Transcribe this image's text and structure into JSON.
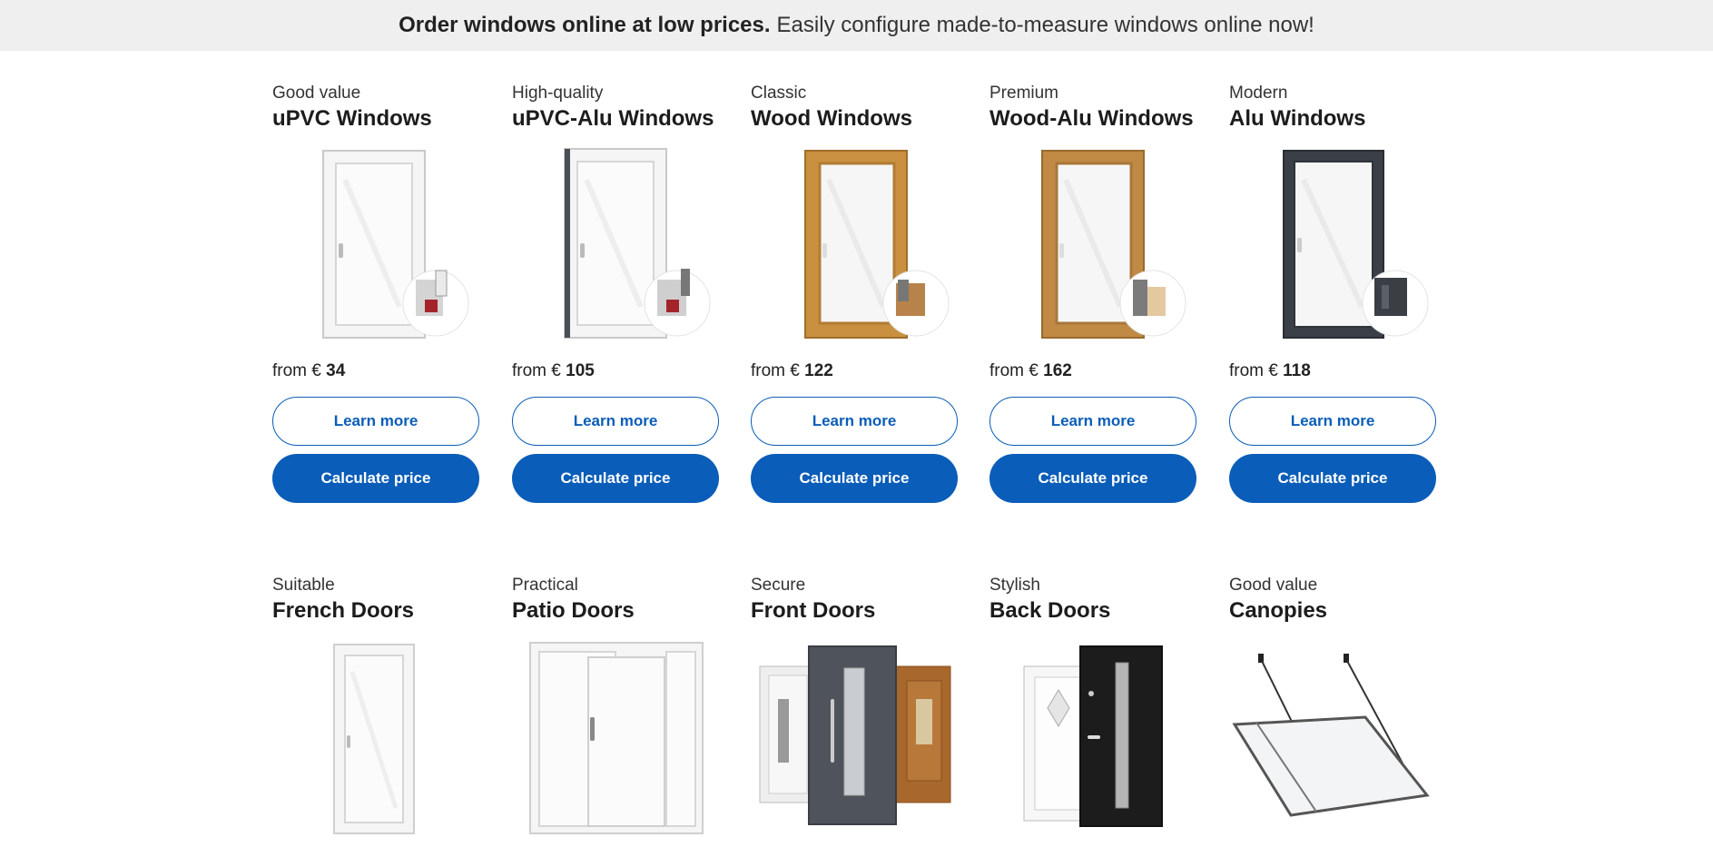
{
  "banner": {
    "bold": "Order windows online at low prices.",
    "text": "Easily configure made-to-measure windows online now!"
  },
  "windows": [
    {
      "subtitle": "Good value",
      "title": "uPVC Windows",
      "price_prefix": "from €",
      "price": "34",
      "learn": "Learn more",
      "calc": "Calculate price",
      "frame_color": "#f4f4f4"
    },
    {
      "subtitle": "High-quality",
      "title": "uPVC-Alu Windows",
      "price_prefix": "from €",
      "price": "105",
      "learn": "Learn more",
      "calc": "Calculate price",
      "frame_color": "#f4f4f4"
    },
    {
      "subtitle": "Classic",
      "title": "Wood Windows",
      "price_prefix": "from €",
      "price": "122",
      "learn": "Learn more",
      "calc": "Calculate price",
      "frame_color": "#c9913f"
    },
    {
      "subtitle": "Premium",
      "title": "Wood-Alu Windows",
      "price_prefix": "from €",
      "price": "162",
      "learn": "Learn more",
      "calc": "Calculate price",
      "frame_color": "#c08a45"
    },
    {
      "subtitle": "Modern",
      "title": "Alu Windows",
      "price_prefix": "from €",
      "price": "118",
      "learn": "Learn more",
      "calc": "Calculate price",
      "frame_color": "#3b4048"
    }
  ],
  "doors": [
    {
      "subtitle": "Suitable",
      "title": "French Doors"
    },
    {
      "subtitle": "Practical",
      "title": "Patio Doors"
    },
    {
      "subtitle": "Secure",
      "title": "Front Doors"
    },
    {
      "subtitle": "Stylish",
      "title": "Back Doors"
    },
    {
      "subtitle": "Good value",
      "title": "Canopies"
    }
  ],
  "colors": {
    "accent": "#0a5db8",
    "banner_bg": "#efefef"
  }
}
